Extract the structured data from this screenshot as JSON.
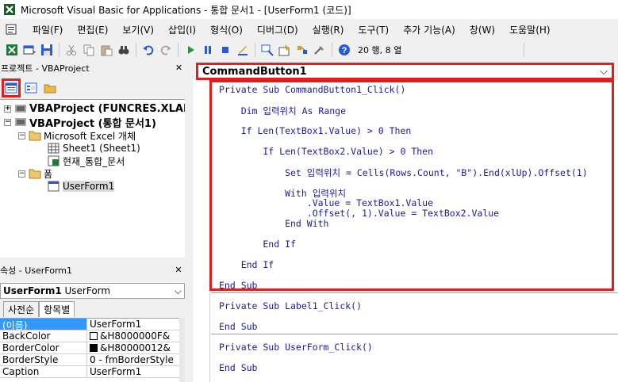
{
  "window": {
    "title": "Microsoft Visual Basic for Applications - 통합 문서1 - [UserForm1 (코드)]"
  },
  "menu": {
    "items": [
      "파일(F)",
      "편집(E)",
      "보기(V)",
      "삽입(I)",
      "형식(O)",
      "디버그(D)",
      "실행(R)",
      "도구(T)",
      "추가 기능(A)",
      "창(W)",
      "도움말(H)"
    ]
  },
  "toolbar": {
    "position": "20 행, 8 열"
  },
  "project": {
    "title": "프로젝트 - VBAProject",
    "tree": [
      {
        "label": "VBAProject (FUNCRES.XLAM",
        "bold": true,
        "expander": "+"
      },
      {
        "label": "VBAProject (통합 문서1)",
        "bold": true,
        "expander": "-"
      },
      {
        "label": "Microsoft Excel 개체",
        "bold": false,
        "expander": "-"
      },
      {
        "label": "Sheet1 (Sheet1)",
        "bold": false,
        "expander": ""
      },
      {
        "label": "현재_통합_문서",
        "bold": false,
        "expander": ""
      },
      {
        "label": "폼",
        "bold": false,
        "expander": "-"
      },
      {
        "label": "UserForm1",
        "bold": false,
        "expander": ""
      }
    ]
  },
  "properties": {
    "title": "속성 - UserForm1",
    "object_name": "UserForm1",
    "object_type": "UserForm",
    "tabs": [
      "사전순",
      "항목별"
    ],
    "rows": [
      {
        "name": "(이름)",
        "value": "UserForm1",
        "swatch": ""
      },
      {
        "name": "BackColor",
        "value": "&H8000000F&",
        "swatch": "#ffffff"
      },
      {
        "name": "BorderColor",
        "value": "&H80000012&",
        "swatch": "#000000"
      },
      {
        "name": "BorderStyle",
        "value": "0 - fmBorderStyle",
        "swatch": ""
      },
      {
        "name": "Caption",
        "value": "UserForm1",
        "swatch": ""
      }
    ]
  },
  "code": {
    "object_combo": "CommandButton1",
    "lines": [
      "Private Sub CommandButton1_Click()",
      "    Dim 입력위치 As Range",
      "    If Len(TextBox1.Value) > 0 Then",
      "        If Len(TextBox2.Value) > 0 Then",
      "            Set 입력위치 = Cells(Rows.Count, \"B\").End(xlUp).Offset(1)",
      "            With 입력위치",
      "                .Value = TextBox1.Value",
      "                .Offset(, 1).Value = TextBox2.Value",
      "            End With",
      "        End If",
      "    End If",
      "End Sub",
      "Private Sub Label1_Click()",
      "End Sub",
      "Private Sub UserForm_Click()",
      "End Sub"
    ]
  },
  "colors": {
    "highlight": "#e02020",
    "code_text": "#1a1a9e"
  }
}
